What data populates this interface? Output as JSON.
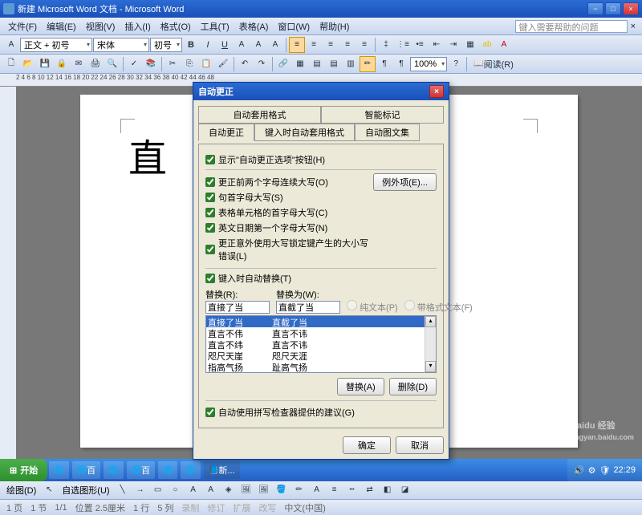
{
  "window": {
    "title": "新建 Microsoft Word 文档 - Microsoft Word"
  },
  "menu": {
    "file": "文件(F)",
    "edit": "编辑(E)",
    "view": "视图(V)",
    "insert": "插入(I)",
    "format": "格式(O)",
    "tools": "工具(T)",
    "table": "表格(A)",
    "window": "窗口(W)",
    "help": "帮助(H)",
    "question": "键入需要帮助的问题"
  },
  "format_toolbar": {
    "style": "正文 + 初号",
    "font": "宋体",
    "size": "初号",
    "zoom": "100%",
    "reading": "阅读(R)"
  },
  "ruler": "2  4  6  8  10  12  14  16  18  20  22  24  26  28  30  32  34  36  38  40  42  44  46  48",
  "document": {
    "visible_text": "直"
  },
  "dialog": {
    "title": "自动更正",
    "tabs_row1": [
      "自动套用格式",
      "智能标记"
    ],
    "tabs_row2": [
      "自动更正",
      "键入时自动套用格式",
      "自动图文集"
    ],
    "active_tab": "自动更正",
    "chk_show": "显示\"自动更正选项\"按钮(H)",
    "chk_twocaps": "更正前两个字母连续大写(O)",
    "chk_sentence": "句首字母大写(S)",
    "chk_tablecell": "表格单元格的首字母大写(C)",
    "chk_days": "英文日期第一个字母大写(N)",
    "chk_capslock": "更正意外使用大写锁定键产生的大小写错误(L)",
    "chk_replace": "键入时自动替换(T)",
    "btn_exceptions": "例外项(E)...",
    "lbl_replace": "替换(R):",
    "lbl_with": "替换为(W):",
    "radio_plain": "纯文本(P)",
    "radio_formatted": "带格式文本(F)",
    "input_replace": "直接了当",
    "input_with": "直截了当",
    "list": [
      {
        "a": "直接了当",
        "b": "直截了当",
        "sel": true
      },
      {
        "a": "直言不伟",
        "b": "直言不讳"
      },
      {
        "a": "直言不纬",
        "b": "直言不讳"
      },
      {
        "a": "咫尺天崖",
        "b": "咫尺天涯"
      },
      {
        "a": "指高气扬",
        "b": "趾高气扬"
      }
    ],
    "btn_replace_do": "替换(A)",
    "btn_delete": "删除(D)",
    "chk_spell": "自动使用拼写检查器提供的建议(G)",
    "btn_ok": "确定",
    "btn_cancel": "取消"
  },
  "drawbar": {
    "label": "绘图(D)",
    "autoshape": "自选图形(U)"
  },
  "status": {
    "page": "1 页",
    "sec": "1 节",
    "pg": "1/1",
    "pos": "位置 2.5厘米",
    "ln": "1 行",
    "col": "5 列",
    "rec": "录制",
    "rev": "修订",
    "ext": "扩展",
    "ovr": "改写",
    "lang": "中文(中国)"
  },
  "taskbar": {
    "start": "开始",
    "items": [
      "百",
      "百",
      "新..."
    ],
    "time": "22:29"
  },
  "watermark": {
    "brand": "Baidu 经验",
    "url": "jingyan.baidu.com"
  }
}
